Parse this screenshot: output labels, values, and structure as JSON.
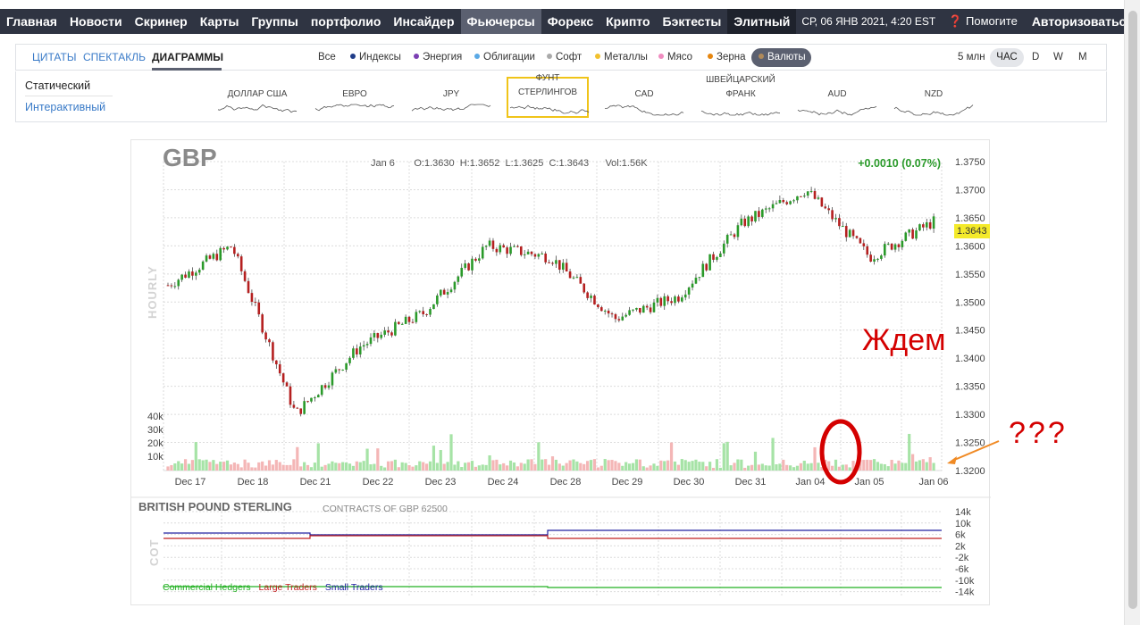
{
  "topnav": {
    "items": [
      "Главная",
      "Новости",
      "Скринер",
      "Карты",
      "Группы",
      "портфолио",
      "Инсайдер",
      "Фьючерсы",
      "Форекс",
      "Крипто",
      "Бэктесты",
      "Элитный"
    ],
    "datetime": "СР, 06 ЯНВ 2021, 4:20 EST",
    "help": "Помогите",
    "auth": "Авторизоваться"
  },
  "subbar": {
    "tabs": [
      "ЦИТАТЫ",
      "СПЕКТАКЛЬ",
      "ДИАГРАММЫ"
    ],
    "filters": [
      {
        "label": "Все",
        "color": ""
      },
      {
        "label": "Индексы",
        "color": "#1f3c88"
      },
      {
        "label": "Энергия",
        "color": "#7b3fb3"
      },
      {
        "label": "Облигации",
        "color": "#5aa9e6"
      },
      {
        "label": "Софт",
        "color": "#aaaaaa"
      },
      {
        "label": "Металлы",
        "color": "#f2c12e"
      },
      {
        "label": "Мясо",
        "color": "#f08cc0"
      },
      {
        "label": "Зерна",
        "color": "#e6860f"
      }
    ],
    "active_filter": "Валюты",
    "active_filter_color": "#b08a5a",
    "timeframes": [
      "5 млн",
      "ЧАС",
      "D",
      "W",
      "M"
    ]
  },
  "modes": {
    "static": "Статический",
    "interactive": "Интерактивный"
  },
  "currencies": [
    {
      "label": "ДОЛЛАР США"
    },
    {
      "label": "ЕВРО"
    },
    {
      "label": "JPY"
    },
    {
      "label": "ФУНТ СТЕРЛИНГОВ"
    },
    {
      "label": "CAD"
    },
    {
      "label": "ШВЕЙЦАРСКИЙ ФРАНК"
    },
    {
      "label": "AUD"
    },
    {
      "label": "NZD"
    }
  ],
  "chart": {
    "symbol": "GBP",
    "ohlc": {
      "date": "Jan 6",
      "open": "O:1.3630",
      "high": "H:1.3652",
      "low": "L:1.3625",
      "close": "C:1.3643",
      "vol": "Vol:1.56K"
    },
    "change": "+0.0010 (0.07%)",
    "side_label": "HOURLY",
    "last_price": "1.3643",
    "price_ticks": [
      "1.3750",
      "1.3700",
      "1.3650",
      "1.3600",
      "1.3550",
      "1.3500",
      "1.3450",
      "1.3400",
      "1.3350",
      "1.3300",
      "1.3250",
      "1.3200"
    ],
    "volume_ticks": [
      "40k",
      "30k",
      "20k",
      "10k"
    ],
    "date_ticks": [
      "Dec 17",
      "Dec 18",
      "Dec 21",
      "Dec 22",
      "Dec 23",
      "Dec 24",
      "Dec 28",
      "Dec 29",
      "Dec 30",
      "Dec 31",
      "Jan 04",
      "Jan 05",
      "Jan 06"
    ]
  },
  "chart_data": {
    "type": "line",
    "title": "GBP",
    "subtitle": "HOURLY",
    "x": [
      "Dec 17",
      "Dec 18",
      "Dec 21",
      "Dec 22",
      "Dec 23",
      "Dec 24",
      "Dec 28",
      "Dec 29",
      "Dec 30",
      "Dec 31",
      "Jan 04",
      "Jan 05",
      "Jan 06"
    ],
    "series": [
      {
        "values": [
          1.353,
          1.36,
          1.33,
          1.342,
          1.348,
          1.36,
          1.358,
          1.347,
          1.351,
          1.364,
          1.37,
          1.358,
          1.3643
        ]
      }
    ],
    "ylim": [
      1.32,
      1.375
    ],
    "grid": true
  },
  "cot": {
    "title": "BRITISH POUND STERLING",
    "contracts": "CONTRACTS OF GBP 62500",
    "side_label": "COT",
    "ticks": [
      "14k",
      "10k",
      "6k",
      "2k",
      "-2k",
      "-6k",
      "-10k",
      "-14k"
    ],
    "legend": [
      {
        "label": "Commercial Hedgers",
        "color": "#22b022"
      },
      {
        "label": "Large Traders",
        "color": "#c02020"
      },
      {
        "label": "Small Traders",
        "color": "#2020a0"
      }
    ]
  },
  "annotations": {
    "wait": "Ждем",
    "question": "???"
  }
}
